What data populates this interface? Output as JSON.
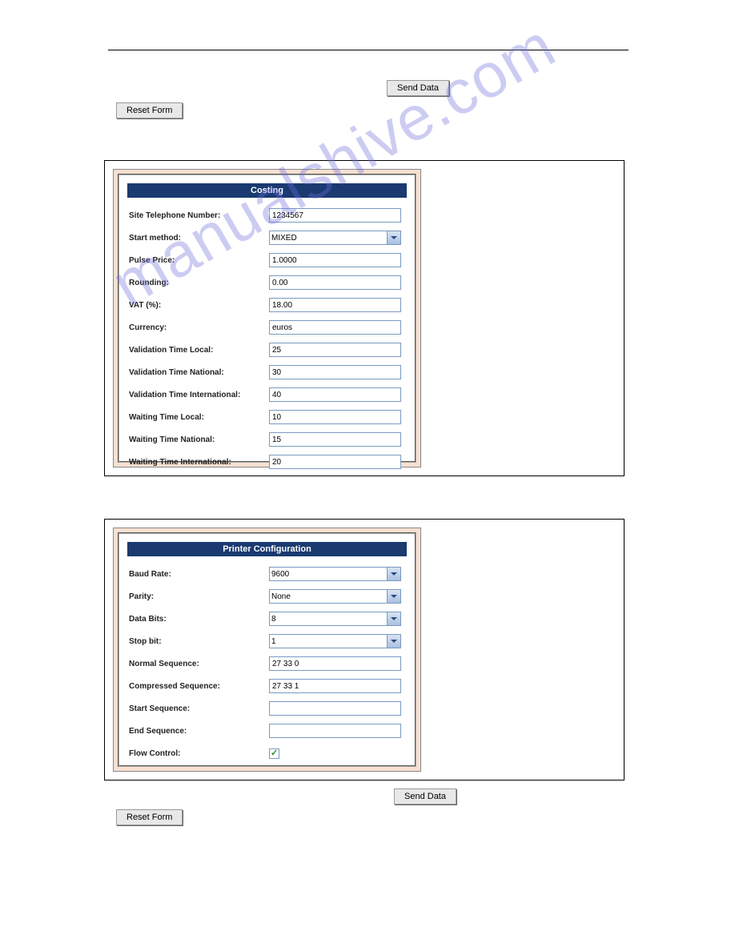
{
  "watermark": "manualshive.com",
  "buttons": {
    "send_data": "Send Data",
    "reset_form": "Reset Form"
  },
  "costing": {
    "header": "Costing",
    "rows": [
      {
        "label": "Site Telephone Number:",
        "type": "text",
        "value": "1234567"
      },
      {
        "label": "Start method:",
        "type": "select",
        "value": "MIXED"
      },
      {
        "label": "Pulse Price:",
        "type": "text",
        "value": "1.0000"
      },
      {
        "label": "Rounding:",
        "type": "text",
        "value": "0.00"
      },
      {
        "label": "VAT (%):",
        "type": "text",
        "value": "18.00"
      },
      {
        "label": "Currency:",
        "type": "text",
        "value": "euros"
      },
      {
        "label": "Validation Time Local:",
        "type": "text",
        "value": "25"
      },
      {
        "label": "Validation Time National:",
        "type": "text",
        "value": "30"
      },
      {
        "label": "Validation Time International:",
        "type": "text",
        "value": "40"
      },
      {
        "label": "Waiting Time Local:",
        "type": "text",
        "value": "10"
      },
      {
        "label": "Waiting Time National:",
        "type": "text",
        "value": "15"
      },
      {
        "label": "Waiting Time International:",
        "type": "text",
        "value": "20"
      }
    ]
  },
  "printer": {
    "header": "Printer Configuration",
    "rows": [
      {
        "label": "Baud Rate:",
        "type": "select",
        "value": "9600"
      },
      {
        "label": "Parity:",
        "type": "select",
        "value": "None"
      },
      {
        "label": "Data Bits:",
        "type": "select",
        "value": "8"
      },
      {
        "label": "Stop bit:",
        "type": "select",
        "value": "1"
      },
      {
        "label": "Normal Sequence:",
        "type": "text",
        "value": "27 33 0"
      },
      {
        "label": "Compressed Sequence:",
        "type": "text",
        "value": "27 33 1"
      },
      {
        "label": "Start Sequence:",
        "type": "text",
        "value": ""
      },
      {
        "label": "End Sequence:",
        "type": "text",
        "value": ""
      },
      {
        "label": "Flow Control:",
        "type": "checkbox",
        "checked": true
      }
    ]
  }
}
